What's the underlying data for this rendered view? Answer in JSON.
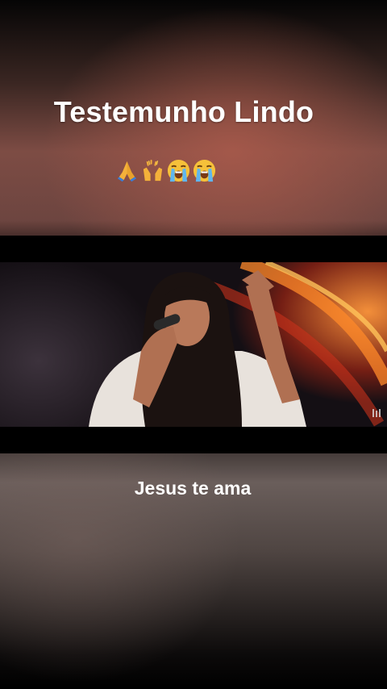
{
  "overlay": {
    "title": "Testemunho Lindo",
    "caption": "Jesus te ama",
    "emojis": [
      "folded-hands-emoji",
      "raised-hands-emoji",
      "loudly-crying-face-emoji",
      "loudly-crying-face-emoji"
    ]
  },
  "colors": {
    "text": "#ffffff",
    "background_top": "#7d4c44",
    "background_bottom": "#4f4542",
    "stage_light": "#ff9a3c"
  }
}
